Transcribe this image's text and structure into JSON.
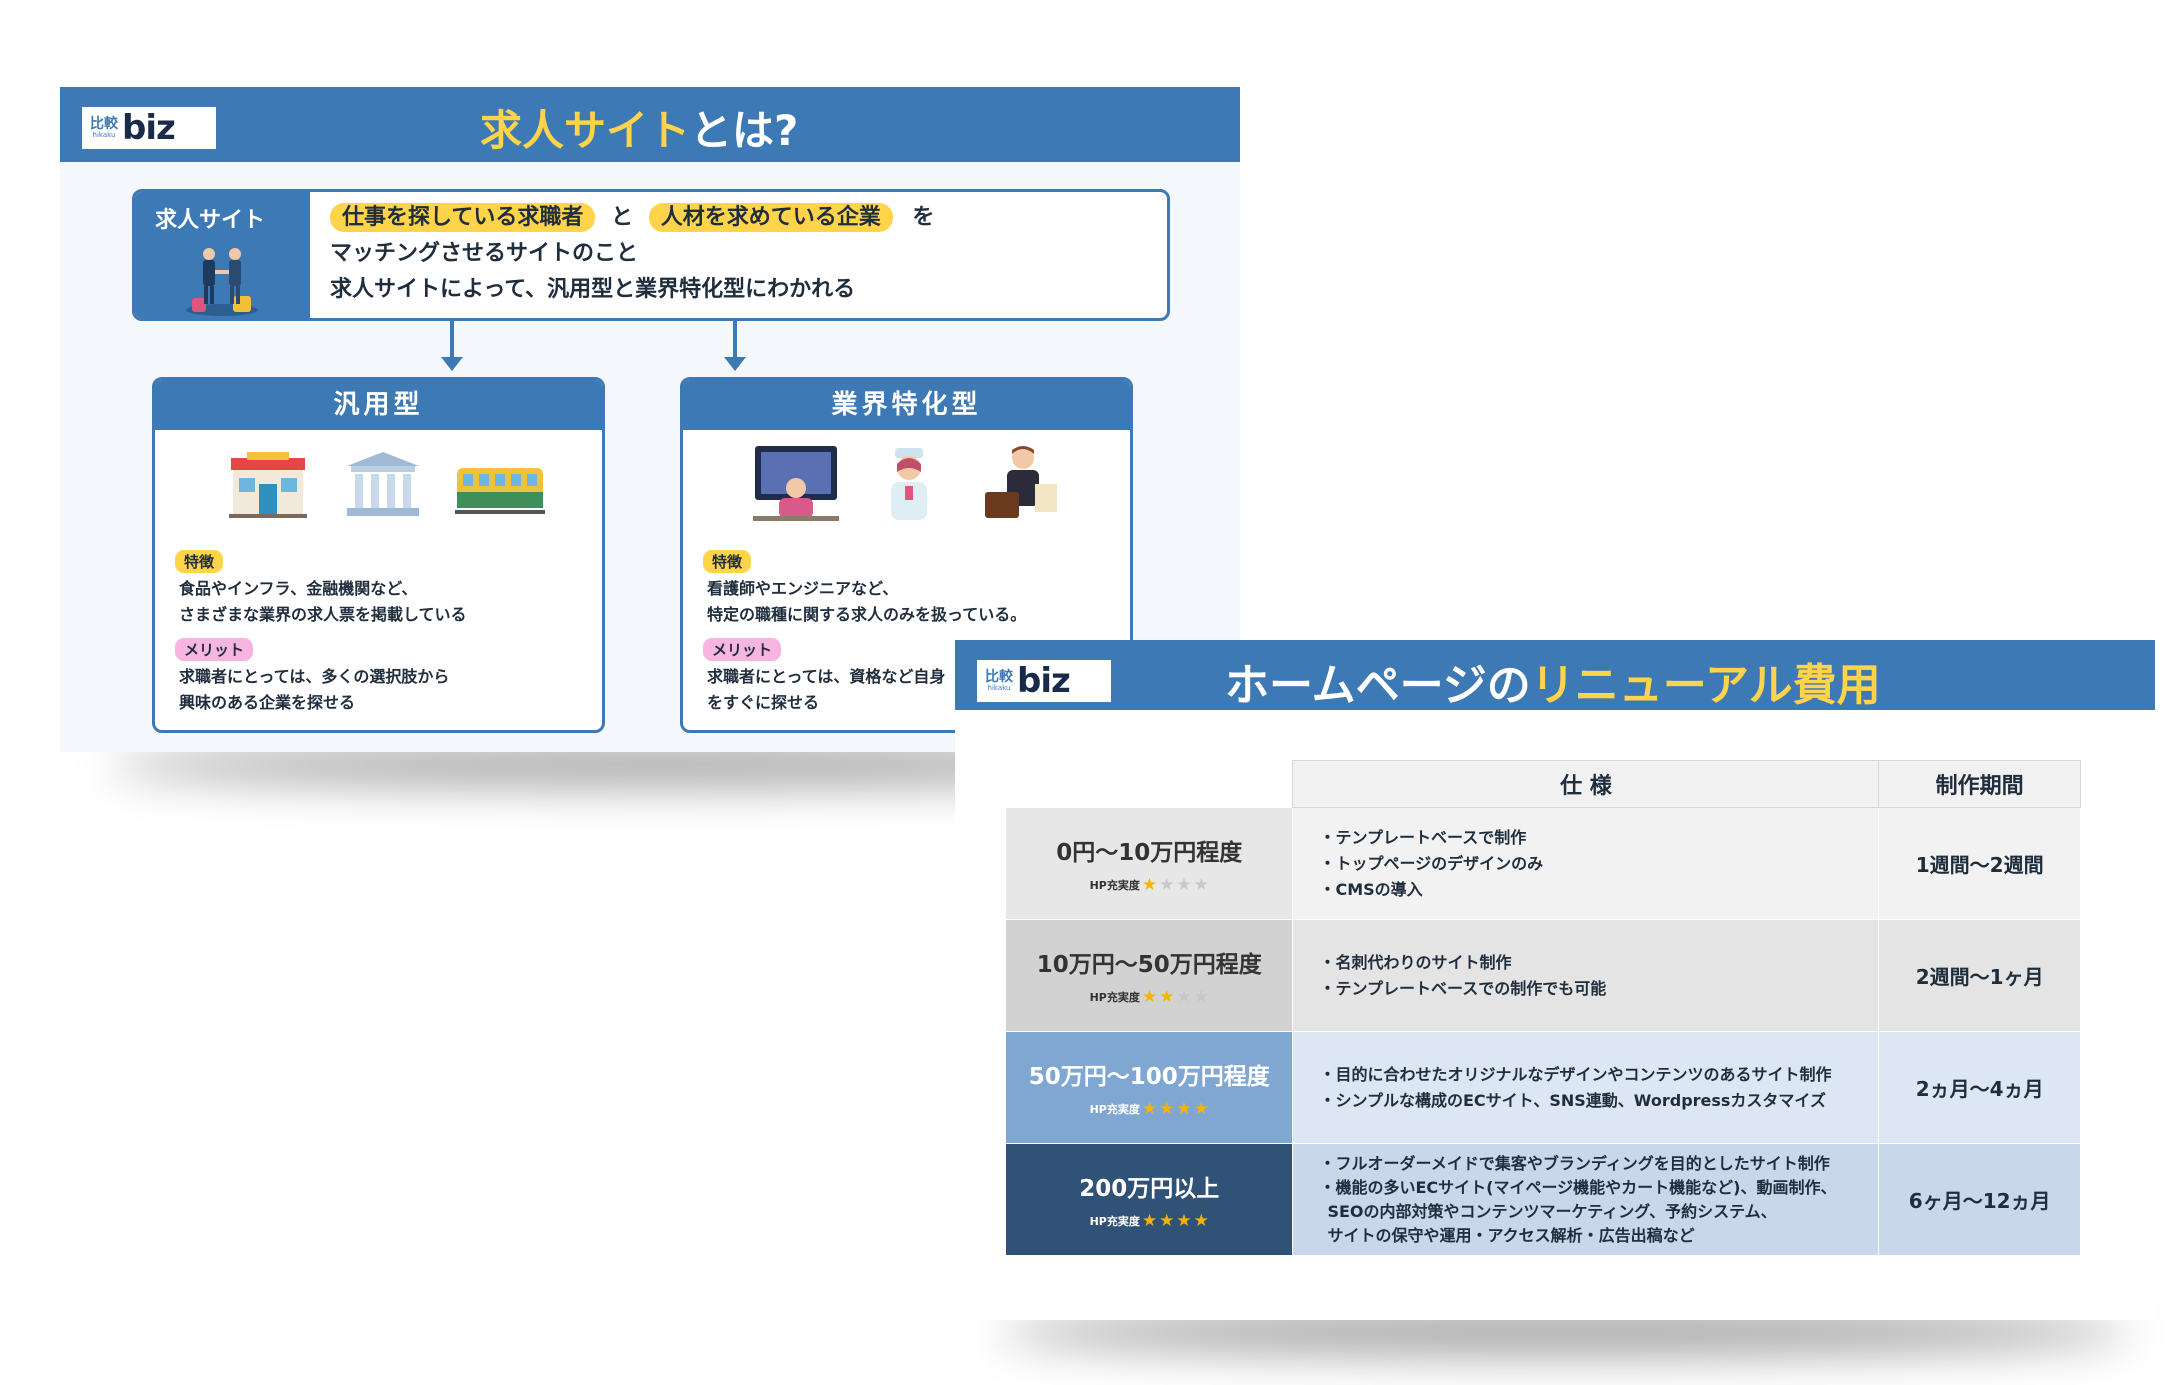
{
  "logo": {
    "jp": "比較",
    "romaji": "hikaku",
    "brand": "biz"
  },
  "slide1": {
    "title_part1": "求人サイト",
    "title_part2": "とは?",
    "definition": {
      "label": "求人サイト",
      "highlight1": "仕事を探している求職者",
      "connector": "と",
      "highlight2": "人材を求めている企業",
      "suffix": "を",
      "line2": "マッチングさせるサイトのこと",
      "line3": "求人サイトによって、汎用型と業界特化型にわかれる"
    },
    "types": [
      {
        "heading": "汎用型",
        "feature_tag": "特徴",
        "feature_lines": [
          "食品やインフラ、金融機関など、",
          "さまざまな業界の求人票を掲載している"
        ],
        "merit_tag": "メリット",
        "merit_lines": [
          "求職者にとっては、多くの選択肢から",
          "興味のある企業を探せる"
        ]
      },
      {
        "heading": "業界特化型",
        "feature_tag": "特徴",
        "feature_lines": [
          "看護師やエンジニアなど、",
          "特定の職種に関する求人のみを扱っている。"
        ],
        "merit_tag": "メリット",
        "merit_lines": [
          "求職者にとっては、資格など自身",
          "をすぐに探せる"
        ]
      }
    ]
  },
  "slide2": {
    "title_part1": "ホームページの",
    "title_part2": "リニューアル費用",
    "columns": {
      "spec": "仕 様",
      "period": "制作期間"
    },
    "rating_label": "HP充実度",
    "rows": [
      {
        "name": "0円〜10万円程度",
        "stars": 1,
        "specs": [
          "・テンプレートベースで制作",
          "・トップページのデザインのみ",
          "・CMSの導入"
        ],
        "period": "1週間〜2週間"
      },
      {
        "name": "10万円〜50万円程度",
        "stars": 2,
        "specs": [
          "・名刺代わりのサイト制作",
          "・テンプレートベースでの制作でも可能"
        ],
        "period": "2週間〜1ヶ月"
      },
      {
        "name": "50万円〜100万円程度",
        "stars": 4,
        "specs": [
          "・目的に合わせたオリジナルなデザインやコンテンツのあるサイト制作",
          "・シンプルな構成のECサイト、SNS連動、Wordpressカスタマイズ"
        ],
        "period": "2ヵ月〜4ヵ月"
      },
      {
        "name": "200万円以上",
        "stars": 4,
        "specs": [
          "・フルオーダーメイドで集客やブランディングを目的としたサイト制作",
          "・機能の多いECサイト(マイページ機能やカート機能など)、動画制作、",
          "SEOの内部対策やコンテンツマーケティング、予約システム、",
          "サイトの保守や運用・アクセス解析・広告出稿など"
        ],
        "period": "6ヶ月〜12ヵ月"
      }
    ]
  },
  "colors": {
    "brand_blue": "#3d79b4",
    "highlight_yellow": "#ffd34a",
    "merit_pink": "#f6b6df",
    "dark_navy": "#2f5276"
  }
}
